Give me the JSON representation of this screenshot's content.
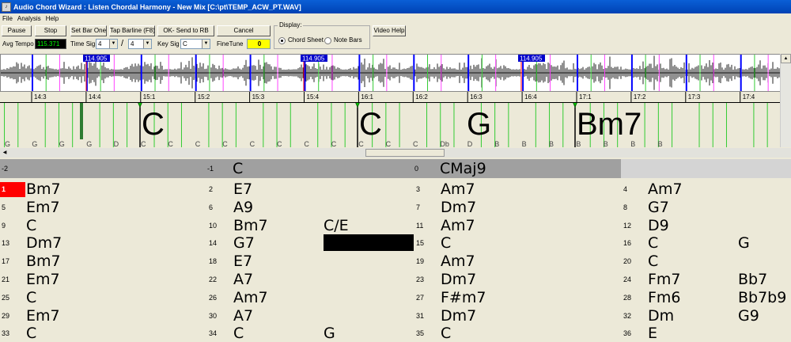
{
  "window": {
    "title": "Audio Chord Wizard : Listen Chordal Harmony - New Mix [C:\\pt\\TEMP_ACW_PT.WAV]"
  },
  "menu": [
    "File",
    "Analysis",
    "Help"
  ],
  "toolbar": {
    "pause_label": "Pause",
    "stop_label": "Stop",
    "set_bar_one_label": "Set Bar One",
    "tap_barline_label": "Tap Barline (F8)",
    "ok_send_label": "OK- Send to RB",
    "cancel_label": "Cancel",
    "video_help_label": "Video Help",
    "avg_tempo_label": "Avg Tempo",
    "avg_tempo_value": "115.371",
    "time_sig_label": "Time Sig",
    "time_sig_num": "4",
    "time_sig_slash": "/",
    "time_sig_den": "4",
    "key_sig_label": "Key Sig",
    "key_sig_value": "C",
    "finetune_label": "FineTune",
    "finetune_value": "0",
    "display_label": "Display:",
    "chord_sheet_label": "Chord Sheet",
    "note_bars_label": "Note Bars",
    "display_selected": "Chord Sheet"
  },
  "waveform": {
    "tempo_flags": [
      "114.905",
      "114.905",
      "114.905"
    ],
    "timeline_labels": [
      "14:3",
      "14:4",
      "15:1",
      "15:2",
      "15:3",
      "15:4",
      "16:1",
      "16:2",
      "16:3",
      "16:4",
      "17:1",
      "17:2",
      "17:3",
      "17:4"
    ]
  },
  "chord_lane": {
    "big_chords": [
      "C",
      "C",
      "G",
      "Bm7"
    ],
    "bass_notes": [
      "G",
      "G",
      "G",
      "G",
      "D",
      "C",
      "C",
      "C",
      "C",
      "C",
      "C",
      "C",
      "C",
      "C",
      "C",
      "C",
      "Db",
      "D",
      "B",
      "B",
      "B",
      "B",
      "B",
      "B",
      "B"
    ]
  },
  "colors": {
    "accent": "#0000ff",
    "current_bar": "#ff0000",
    "header_row": "#a0a0a0",
    "finetune_bg": "#ffff00",
    "tempo_bg": "#000000",
    "tempo_fg": "#00ff00"
  },
  "sheet": {
    "header": [
      {
        "num": "-2",
        "c1": "",
        "c2": ""
      },
      {
        "num": "-1",
        "c1": "C",
        "c2": ""
      },
      {
        "num": "0",
        "c1": "CMaj9",
        "c2": ""
      }
    ],
    "rows": [
      [
        {
          "num": "1",
          "c1": "Bm7",
          "c2": "",
          "current": true
        },
        {
          "num": "2",
          "c1": "E7",
          "c2": ""
        },
        {
          "num": "3",
          "c1": "Am7",
          "c2": ""
        },
        {
          "num": "4",
          "c1": "Am7",
          "c2": ""
        }
      ],
      [
        {
          "num": "5",
          "c1": "Em7",
          "c2": ""
        },
        {
          "num": "6",
          "c1": "A9",
          "c2": ""
        },
        {
          "num": "7",
          "c1": "Dm7",
          "c2": ""
        },
        {
          "num": "8",
          "c1": "G7",
          "c2": ""
        }
      ],
      [
        {
          "num": "9",
          "c1": "C",
          "c2": ""
        },
        {
          "num": "10",
          "c1": "Bm7",
          "c2": "C/E"
        },
        {
          "num": "11",
          "c1": "Am7",
          "c2": ""
        },
        {
          "num": "12",
          "c1": "D9",
          "c2": ""
        }
      ],
      [
        {
          "num": "13",
          "c1": "Dm7",
          "c2": ""
        },
        {
          "num": "14",
          "c1": "G7",
          "c2": "",
          "block": true
        },
        {
          "num": "15",
          "c1": "C",
          "c2": ""
        },
        {
          "num": "16",
          "c1": "C",
          "c2": "G"
        }
      ],
      [
        {
          "num": "17",
          "c1": "Bm7",
          "c2": ""
        },
        {
          "num": "18",
          "c1": "E7",
          "c2": ""
        },
        {
          "num": "19",
          "c1": "Am7",
          "c2": ""
        },
        {
          "num": "20",
          "c1": "C",
          "c2": ""
        }
      ],
      [
        {
          "num": "21",
          "c1": "Em7",
          "c2": ""
        },
        {
          "num": "22",
          "c1": "A7",
          "c2": ""
        },
        {
          "num": "23",
          "c1": "Dm7",
          "c2": ""
        },
        {
          "num": "24",
          "c1": "Fm7",
          "c2": "Bb7"
        }
      ],
      [
        {
          "num": "25",
          "c1": "C",
          "c2": ""
        },
        {
          "num": "26",
          "c1": "Am7",
          "c2": ""
        },
        {
          "num": "27",
          "c1": "F#m7",
          "c2": ""
        },
        {
          "num": "28",
          "c1": "Fm6",
          "c2": "Bb7b9"
        }
      ],
      [
        {
          "num": "29",
          "c1": "Em7",
          "c2": ""
        },
        {
          "num": "30",
          "c1": "A7",
          "c2": ""
        },
        {
          "num": "31",
          "c1": "Dm7",
          "c2": ""
        },
        {
          "num": "32",
          "c1": "Dm",
          "c2": "G9"
        }
      ],
      [
        {
          "num": "33",
          "c1": "C",
          "c2": ""
        },
        {
          "num": "34",
          "c1": "C",
          "c2": "G"
        },
        {
          "num": "35",
          "c1": "C",
          "c2": ""
        },
        {
          "num": "36",
          "c1": "E",
          "c2": ""
        }
      ]
    ]
  }
}
